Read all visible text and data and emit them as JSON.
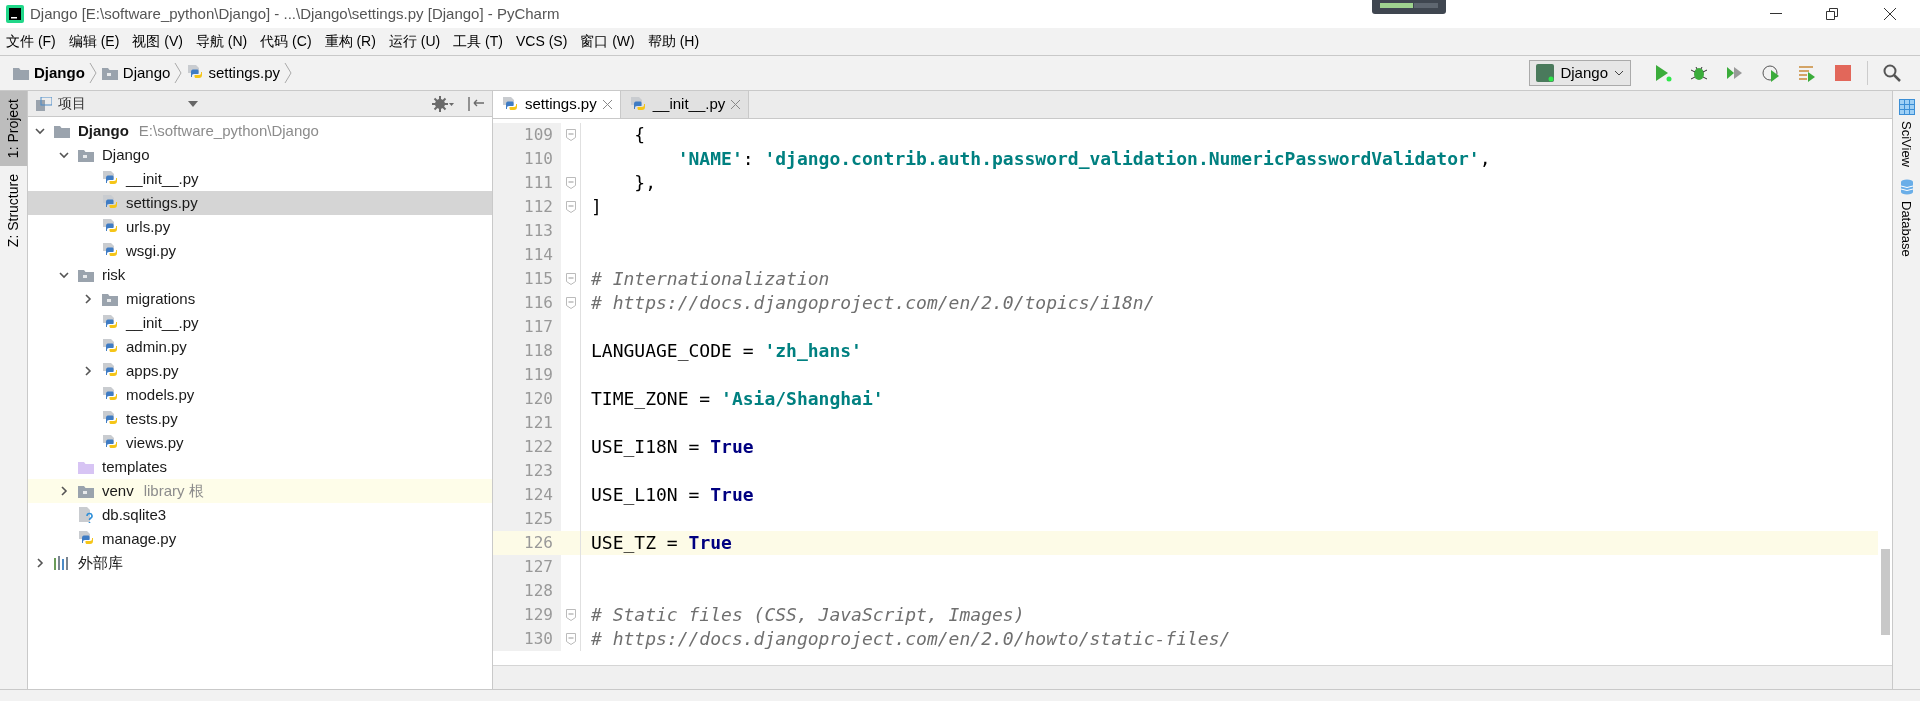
{
  "window": {
    "title": "Django [E:\\software_python\\Django] - ...\\Django\\settings.py [Django] - PyCharm"
  },
  "menu": [
    "文件 (F)",
    "编辑 (E)",
    "视图 (V)",
    "导航 (N)",
    "代码 (C)",
    "重构 (R)",
    "运行 (U)",
    "工具 (T)",
    "VCS (S)",
    "窗口 (W)",
    "帮助 (H)"
  ],
  "breadcrumbs": [
    {
      "label": "Django",
      "kind": "root"
    },
    {
      "label": "Django",
      "kind": "package"
    },
    {
      "label": "settings.py",
      "kind": "python"
    }
  ],
  "run_config": {
    "label": "Django"
  },
  "left_tool_tabs": [
    {
      "label": "1: Project",
      "selected": true
    },
    {
      "label": "Z: Structure",
      "selected": false
    }
  ],
  "right_tool_tabs": [
    {
      "label": "SciView",
      "kind": "grid"
    },
    {
      "label": "Database",
      "kind": "database"
    }
  ],
  "project_panel": {
    "title": "项目",
    "tree": [
      {
        "label": "Django",
        "note": "E:\\software_python\\Django",
        "kind": "root",
        "selected": false,
        "expanded": true,
        "children": [
          {
            "label": "Django",
            "kind": "package",
            "selected": false,
            "expanded": true,
            "children": [
              {
                "label": "__init__.py",
                "kind": "python",
                "selected": false
              },
              {
                "label": "settings.py",
                "kind": "python",
                "selected": true
              },
              {
                "label": "urls.py",
                "kind": "python",
                "selected": false
              },
              {
                "label": "wsgi.py",
                "kind": "python",
                "selected": false
              }
            ]
          },
          {
            "label": "risk",
            "kind": "package",
            "selected": false,
            "expanded": true,
            "children": [
              {
                "label": "migrations",
                "kind": "package",
                "selected": false,
                "expanded": false
              },
              {
                "label": "__init__.py",
                "kind": "python",
                "selected": false
              },
              {
                "label": "admin.py",
                "kind": "python",
                "selected": false
              },
              {
                "label": "apps.py",
                "kind": "python",
                "selected": false,
                "expanded": false
              },
              {
                "label": "models.py",
                "kind": "python",
                "selected": false
              },
              {
                "label": "tests.py",
                "kind": "python",
                "selected": false
              },
              {
                "label": "views.py",
                "kind": "python",
                "selected": false
              }
            ]
          },
          {
            "label": "templates",
            "kind": "templates",
            "selected": false
          },
          {
            "label": "venv",
            "note": "library 根",
            "kind": "library",
            "selected": false,
            "expanded": false
          },
          {
            "label": "db.sqlite3",
            "kind": "unknown",
            "selected": false
          },
          {
            "label": "manage.py",
            "kind": "python",
            "selected": false
          }
        ]
      },
      {
        "label": "外部库",
        "kind": "external",
        "selected": false,
        "expanded": false
      }
    ]
  },
  "editor_tabs": [
    {
      "label": "settings.py",
      "selected": true
    },
    {
      "label": "__init__.py",
      "selected": false
    }
  ],
  "code_lines": [
    {
      "number": "109",
      "fold": true,
      "current": false,
      "tokens": [
        {
          "kind": "plain",
          "text": "    {"
        }
      ]
    },
    {
      "number": "110",
      "fold": false,
      "current": false,
      "tokens": [
        {
          "kind": "string",
          "text": "        'NAME'"
        },
        {
          "kind": "plain",
          "text": ": "
        },
        {
          "kind": "string",
          "text": "'django.contrib.auth.password_validation.NumericPasswordValidator'"
        },
        {
          "kind": "plain",
          "text": ","
        }
      ]
    },
    {
      "number": "111",
      "fold": true,
      "current": false,
      "tokens": [
        {
          "kind": "plain",
          "text": "    },"
        }
      ]
    },
    {
      "number": "112",
      "fold": true,
      "current": false,
      "tokens": [
        {
          "kind": "plain",
          "text": "]"
        }
      ]
    },
    {
      "number": "113",
      "fold": false,
      "current": false
    },
    {
      "number": "114",
      "fold": false,
      "current": false
    },
    {
      "number": "115",
      "fold": true,
      "current": false,
      "tokens": [
        {
          "kind": "comment",
          "text": "# Internationalization"
        }
      ]
    },
    {
      "number": "116",
      "fold": true,
      "current": false,
      "tokens": [
        {
          "kind": "comment",
          "text": "# https://docs.djangoproject.com/en/2.0/topics/i18n/"
        }
      ]
    },
    {
      "number": "117",
      "fold": false,
      "current": false
    },
    {
      "number": "118",
      "fold": false,
      "current": false,
      "tokens": [
        {
          "kind": "plain",
          "text": "LANGUAGE_CODE = "
        },
        {
          "kind": "string",
          "text": "'zh_hans'"
        }
      ]
    },
    {
      "number": "119",
      "fold": false,
      "current": false
    },
    {
      "number": "120",
      "fold": false,
      "current": false,
      "tokens": [
        {
          "kind": "plain",
          "text": "TIME_ZONE = "
        },
        {
          "kind": "string",
          "text": "'Asia/Shanghai'"
        }
      ]
    },
    {
      "number": "121",
      "fold": false,
      "current": false
    },
    {
      "number": "122",
      "fold": false,
      "current": false,
      "tokens": [
        {
          "kind": "plain",
          "text": "USE_I18N = "
        },
        {
          "kind": "keyword",
          "text": "True"
        }
      ]
    },
    {
      "number": "123",
      "fold": false,
      "current": false
    },
    {
      "number": "124",
      "fold": false,
      "current": false,
      "tokens": [
        {
          "kind": "plain",
          "text": "USE_L10N = "
        },
        {
          "kind": "keyword",
          "text": "True"
        }
      ]
    },
    {
      "number": "125",
      "fold": false,
      "current": false
    },
    {
      "number": "126",
      "fold": false,
      "current": true,
      "tokens": [
        {
          "kind": "plain",
          "text": "USE_TZ = "
        },
        {
          "kind": "keyword",
          "text": "True"
        }
      ]
    },
    {
      "number": "127",
      "fold": false,
      "current": false
    },
    {
      "number": "128",
      "fold": false,
      "current": false
    },
    {
      "number": "129",
      "fold": true,
      "current": false,
      "tokens": [
        {
          "kind": "comment",
          "text": "# Static files (CSS, JavaScript, Images)"
        }
      ]
    },
    {
      "number": "130",
      "fold": true,
      "current": false,
      "tokens": [
        {
          "kind": "comment",
          "text": "# https://docs.djangoproject.com/en/2.0/howto/static-files/"
        }
      ]
    }
  ]
}
